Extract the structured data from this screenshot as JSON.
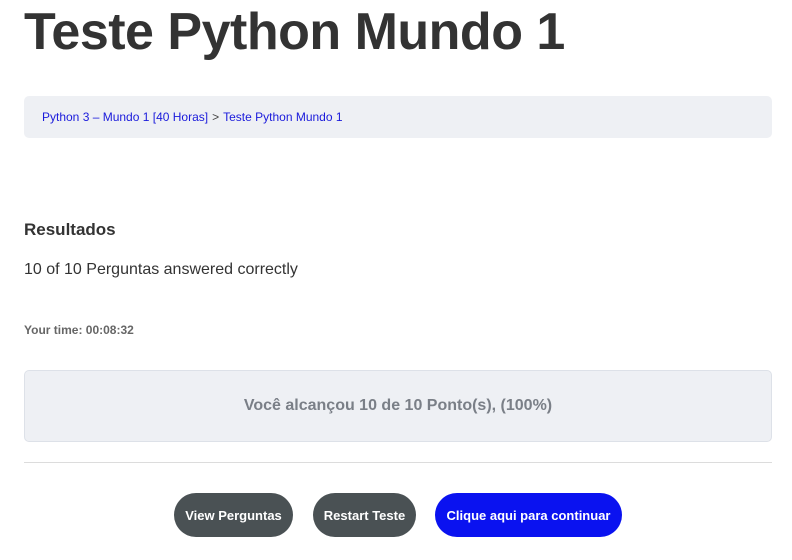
{
  "page": {
    "title": "Teste Python Mundo 1"
  },
  "breadcrumb": {
    "items": [
      {
        "label": "Python 3 – Mundo 1 [40 Horas]"
      },
      {
        "label": "Teste Python Mundo 1"
      }
    ],
    "separator": ">"
  },
  "results": {
    "heading": "Resultados",
    "answered_text": "10 of 10 Perguntas answered correctly",
    "time_text": "Your time: 00:08:32",
    "score_text": "Você alcançou 10 de 10 Ponto(s), (100%)"
  },
  "actions": {
    "view_label": "View Perguntas",
    "restart_label": "Restart Teste",
    "continue_label": "Clique aqui para continuar"
  },
  "colors": {
    "link": "#1a1adb",
    "button_dark": "#4a5154",
    "button_primary": "#0a12f0",
    "panel_bg": "#eef0f4"
  }
}
